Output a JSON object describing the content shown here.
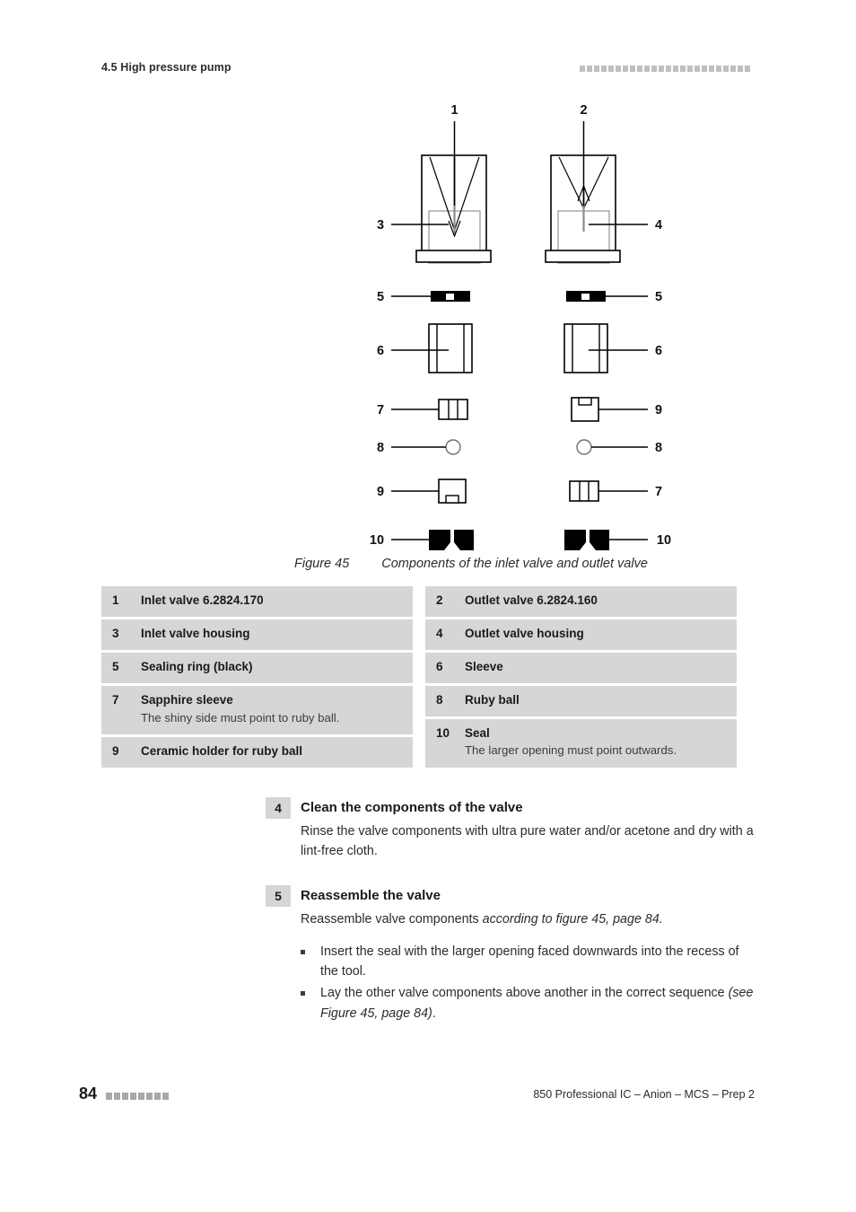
{
  "header": {
    "section_title": "4.5 High pressure pump",
    "decor_square_count": 24,
    "decor_color": "#bfbfbf"
  },
  "figure": {
    "caption_number": "Figure 45",
    "caption_text": "Components of the inlet valve and outlet valve",
    "callouts": {
      "left": [
        "1",
        "3",
        "5",
        "6",
        "7",
        "8",
        "9",
        "10"
      ],
      "right": [
        "2",
        "4",
        "5",
        "6",
        "9",
        "8",
        "7",
        "10"
      ]
    },
    "left_column_title": "inlet valve",
    "right_column_title": "outlet valve"
  },
  "legend": {
    "left_column": [
      {
        "num": "1",
        "label": "Inlet valve 6.2824.170",
        "sub": ""
      },
      {
        "num": "3",
        "label": "Inlet valve housing",
        "sub": ""
      },
      {
        "num": "5",
        "label": "Sealing ring (black)",
        "sub": ""
      },
      {
        "num": "7",
        "label": "Sapphire sleeve",
        "sub": "The shiny side must point to ruby ball."
      },
      {
        "num": "9",
        "label": "Ceramic holder for ruby ball",
        "sub": ""
      }
    ],
    "right_column": [
      {
        "num": "2",
        "label": "Outlet valve 6.2824.160",
        "sub": ""
      },
      {
        "num": "4",
        "label": "Outlet valve housing",
        "sub": ""
      },
      {
        "num": "6",
        "label": "Sleeve",
        "sub": ""
      },
      {
        "num": "8",
        "label": "Ruby ball",
        "sub": ""
      },
      {
        "num": "10",
        "label": "Seal",
        "sub": "The larger opening must point outwards."
      }
    ]
  },
  "steps": [
    {
      "num": "4",
      "title": "Clean the components of the valve",
      "body": "Rinse the valve components with ultra pure water and/or acetone and dry with a lint-free cloth."
    },
    {
      "num": "5",
      "title": "Reassemble the valve",
      "body_plain": "Reassemble valve components ",
      "body_italic": "according to figure 45, page 84.",
      "bullets": [
        {
          "plain": "Insert the seal with the larger opening faced downwards into the recess of the tool.",
          "italic": ""
        },
        {
          "plain": "Lay the other valve components above another in the correct sequence ",
          "italic": "(see Figure 45, page 84)",
          "tail": "."
        }
      ]
    }
  ],
  "footer": {
    "page_number": "84",
    "decor_square_count": 8,
    "decor_color": "#a8a8a8",
    "document_title": "850 Professional IC – Anion – MCS – Prep 2"
  }
}
